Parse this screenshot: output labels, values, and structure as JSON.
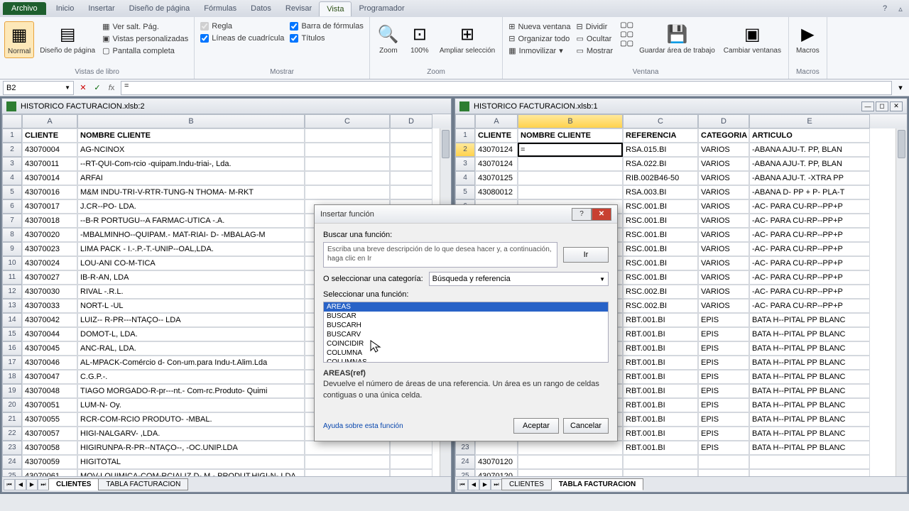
{
  "tabs": {
    "file": "Archivo",
    "items": [
      "Inicio",
      "Insertar",
      "Diseño de página",
      "Fórmulas",
      "Datos",
      "Revisar",
      "Vista",
      "Programador"
    ],
    "active": "Vista"
  },
  "ribbon": {
    "g1": {
      "label": "Vistas de libro",
      "normal": "Normal",
      "layout": "Diseño\nde página",
      "chk1": "Ver salt. Pág.",
      "chk2": "Vistas personalizadas",
      "chk3": "Pantalla completa"
    },
    "g2": {
      "label": "Mostrar",
      "chk1": "Regla",
      "chk2": "Líneas de cuadrícula",
      "chk3": "Barra de fórmulas",
      "chk4": "Títulos"
    },
    "g3": {
      "label": "Zoom",
      "zoom": "Zoom",
      "p100": "100%",
      "sel": "Ampliar\nselección"
    },
    "g4": {
      "label": "Ventana",
      "nv": "Nueva ventana",
      "org": "Organizar todo",
      "inm": "Inmovilizar",
      "div": "Dividir",
      "oc": "Ocultar",
      "mos": "Mostrar",
      "guard": "Guardar área\nde trabajo",
      "camb": "Cambiar\nventanas"
    },
    "g5": {
      "label": "Macros",
      "mac": "Macros"
    }
  },
  "namebox": "B2",
  "formula": "=",
  "win1": {
    "title": "HISTORICO FACTURACION.xlsb:2",
    "cols": [
      "A",
      "B",
      "C",
      "D"
    ],
    "cw": [
      78,
      320,
      120,
      60
    ],
    "rows": [
      [
        "CLIENTE",
        "NOMBRE CLIENTE",
        "",
        ""
      ],
      [
        "43070004",
        "AG-NCINOX",
        "",
        ""
      ],
      [
        "43070011",
        "--RT-QUI-Com-rcio -quipam.Indu-triai-, Lda.",
        "",
        ""
      ],
      [
        "43070014",
        "ARFAI",
        "",
        ""
      ],
      [
        "43070016",
        "M&M INDU-TRI-V-RTR-TUNG-N THOMA- M-RKT",
        "",
        ""
      ],
      [
        "43070017",
        "J.CR--PO- LDA.",
        "",
        ""
      ],
      [
        "43070018",
        "--B-R PORTUGU--A FARMAC-UTICA -.A.",
        "",
        ""
      ],
      [
        "43070020",
        "-MBALMINHO--QUIPAM.- MAT-RIAI- D- -MBALAG-M",
        "",
        ""
      ],
      [
        "43070023",
        "LIMA PACK - I.-.P.-T.-UNIP--OAL,LDA.",
        "",
        ""
      ],
      [
        "43070024",
        "LOU-ANI CO-M-TICA",
        "",
        ""
      ],
      [
        "43070027",
        "IB-R-AN, LDA",
        "",
        ""
      ],
      [
        "43070030",
        "RIVAL -.R.L.",
        "",
        ""
      ],
      [
        "43070033",
        "NORT-L -UL",
        "",
        ""
      ],
      [
        "43070042",
        "LUIZ-- R-PR---NTAÇO-- LDA",
        "",
        ""
      ],
      [
        "43070044",
        "DOMOT-L, LDA.",
        "",
        ""
      ],
      [
        "43070045",
        "ANC-RAL, LDA.",
        "",
        ""
      ],
      [
        "43070046",
        "AL-MPACK-Comércio d- Con-um.para Indu-t.Alim.Lda",
        "",
        ""
      ],
      [
        "43070047",
        "C.G.P.-.",
        "",
        ""
      ],
      [
        "43070048",
        "TIAGO MORGADO-R-pr---nt.- Com-rc.Produto- Quimi",
        "",
        ""
      ],
      [
        "43070051",
        "LUM-N- Oy.",
        "",
        ""
      ],
      [
        "43070055",
        "RCR-COM-RCIO PRODUTO- -MBAL.",
        "",
        ""
      ],
      [
        "43070057",
        "HIGI-NALGARV- ,LDA.",
        "",
        ""
      ],
      [
        "43070058",
        "HIGIRUNPA-R-PR--NTAÇO--, -OC.UNIP.LDA",
        "",
        ""
      ],
      [
        "43070059",
        "HIGITOTAL",
        "",
        ""
      ],
      [
        "43070061",
        "MOV-LQUIMICA-COM-RCIALIZ.D- M.- PRODUT.HIGI-N-,LDA.",
        "",
        ""
      ]
    ],
    "tabs": [
      "CLIENTES",
      "TABLA FACTURACION"
    ],
    "activeTab": 0
  },
  "win2": {
    "title": "HISTORICO FACTURACION.xlsb:1",
    "cols": [
      "A",
      "B",
      "C",
      "D",
      "E"
    ],
    "cw": [
      60,
      148,
      106,
      72,
      170
    ],
    "rows": [
      [
        "CLIENTE",
        "NOMBRE CLIENTE",
        "REFERENCIA",
        "CATEGORIA",
        "ARTICULO"
      ],
      [
        "43070124",
        "=",
        "RSA.015.BI",
        "VARIOS",
        "-ABANA AJU-T. PP, BLAN"
      ],
      [
        "43070124",
        "",
        "RSA.022.BI",
        "VARIOS",
        "-ABANA AJU-T. PP, BLAN"
      ],
      [
        "43070125",
        "",
        "RIB.002B46-50",
        "VARIOS",
        "-ABANA AJU-T. -XTRA PP"
      ],
      [
        "43080012",
        "",
        "RSA.003.BI",
        "VARIOS",
        "-ABANA D- PP + P- PLA-T"
      ],
      [
        "",
        "",
        "RSC.001.BI",
        "VARIOS",
        "-AC- PARA CU-RP--PP+P"
      ],
      [
        "",
        "",
        "RSC.001.BI",
        "VARIOS",
        "-AC- PARA CU-RP--PP+P"
      ],
      [
        "",
        "",
        "RSC.001.BI",
        "VARIOS",
        "-AC- PARA CU-RP--PP+P"
      ],
      [
        "",
        "",
        "RSC.001.BI",
        "VARIOS",
        "-AC- PARA CU-RP--PP+P"
      ],
      [
        "",
        "",
        "RSC.001.BI",
        "VARIOS",
        "-AC- PARA CU-RP--PP+P"
      ],
      [
        "",
        "",
        "RSC.001.BI",
        "VARIOS",
        "-AC- PARA CU-RP--PP+P"
      ],
      [
        "",
        "",
        "RSC.002.BI",
        "VARIOS",
        "-AC- PARA CU-RP--PP+P"
      ],
      [
        "",
        "",
        "RSC.002.BI",
        "VARIOS",
        "-AC- PARA CU-RP--PP+P"
      ],
      [
        "",
        "",
        "RBT.001.BI",
        "EPIS",
        "BATA H--PITAL PP BLANC"
      ],
      [
        "",
        "",
        "RBT.001.BI",
        "EPIS",
        "BATA H--PITAL PP BLANC"
      ],
      [
        "",
        "",
        "RBT.001.BI",
        "EPIS",
        "BATA H--PITAL PP BLANC"
      ],
      [
        "",
        "",
        "RBT.001.BI",
        "EPIS",
        "BATA H--PITAL PP BLANC"
      ],
      [
        "",
        "",
        "RBT.001.BI",
        "EPIS",
        "BATA H--PITAL PP BLANC"
      ],
      [
        "",
        "",
        "RBT.001.BI",
        "EPIS",
        "BATA H--PITAL PP BLANC"
      ],
      [
        "",
        "",
        "RBT.001.BI",
        "EPIS",
        "BATA H--PITAL PP BLANC"
      ],
      [
        "",
        "",
        "RBT.001.BI",
        "EPIS",
        "BATA H--PITAL PP BLANC"
      ],
      [
        "",
        "",
        "RBT.001.BI",
        "EPIS",
        "BATA H--PITAL PP BLANC"
      ],
      [
        "",
        "",
        "RBT.001.BI",
        "EPIS",
        "BATA H--PITAL PP BLANC"
      ],
      [
        "43070120",
        "",
        "",
        "",
        ""
      ],
      [
        "43070120",
        "",
        "",
        "",
        ""
      ]
    ],
    "tabs": [
      "CLIENTES",
      "TABLA FACTURACION"
    ],
    "activeTab": 1,
    "activeCell": {
      "r": 1,
      "c": 1
    }
  },
  "dlg": {
    "title": "Insertar función",
    "searchLbl": "Buscar una función:",
    "searchPh": "Escriba una breve descripción de lo que desea hacer y, a continuación, haga clic en Ir",
    "go": "Ir",
    "catLbl": "O seleccionar una categoría:",
    "catVal": "Búsqueda y referencia",
    "selLbl": "Seleccionar una función:",
    "list": [
      "AREAS",
      "BUSCAR",
      "BUSCARH",
      "BUSCARV",
      "COINCIDIR",
      "COLUMNA",
      "COLUMNAS"
    ],
    "descTitle": "AREAS(ref)",
    "descBody": "Devuelve el número de áreas de una referencia. Un área es un rango de celdas contiguas o una única celda.",
    "help": "Ayuda sobre esta función",
    "ok": "Aceptar",
    "cancel": "Cancelar"
  }
}
